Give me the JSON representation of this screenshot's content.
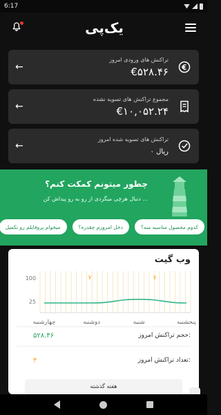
{
  "status": {
    "time": "6:17"
  },
  "appbar": {
    "logo": "یک‌پی"
  },
  "cards": [
    {
      "label": "تراکنش های ورودی امروز",
      "value": "€۵۲۸.۴۶",
      "icon": "euro-arrows-icon"
    },
    {
      "label": "مجموع تراکنش های تسویه نشده",
      "value": "€۱۰,۰۵۲.۲۴",
      "icon": "receipt-icon"
    },
    {
      "label": "تراکنش های تسویه شده امروز",
      "value": "۰ ریال",
      "icon": "check-circle-icon"
    }
  ],
  "help": {
    "title": "چطور میتونم کمکت کنم؟",
    "subtitle": "دنبال هرچی میگردی از رو به رو پیداش کن ...",
    "pills": [
      "کدوم محصول مناسبه منه؟",
      "دخل امروزم چقدره؟",
      "میخوام پروفایلم رو تکمیل"
    ]
  },
  "webgate": {
    "title": "وب گیت",
    "stat1_label": "حجم تراکنش امروز:",
    "stat1_value": "۵۲۸.۴۶",
    "stat2_label": "تعداد تراکنش امروز:",
    "stat2_value": "۴",
    "week_button": "هفته گذشته"
  },
  "chart_data": {
    "type": "line",
    "categories": [
      "چهارشنبه",
      "دوشنبه",
      "شنبه",
      "پنجشنبه"
    ],
    "y_ticks": [
      "100",
      "25"
    ],
    "series": [
      {
        "values": [
          0,
          0,
          2,
          0
        ]
      }
    ],
    "bar_marks": [
      "٧",
      "٧"
    ],
    "colors": {
      "line": "#2fb58a",
      "accent": "#f5a623"
    }
  }
}
